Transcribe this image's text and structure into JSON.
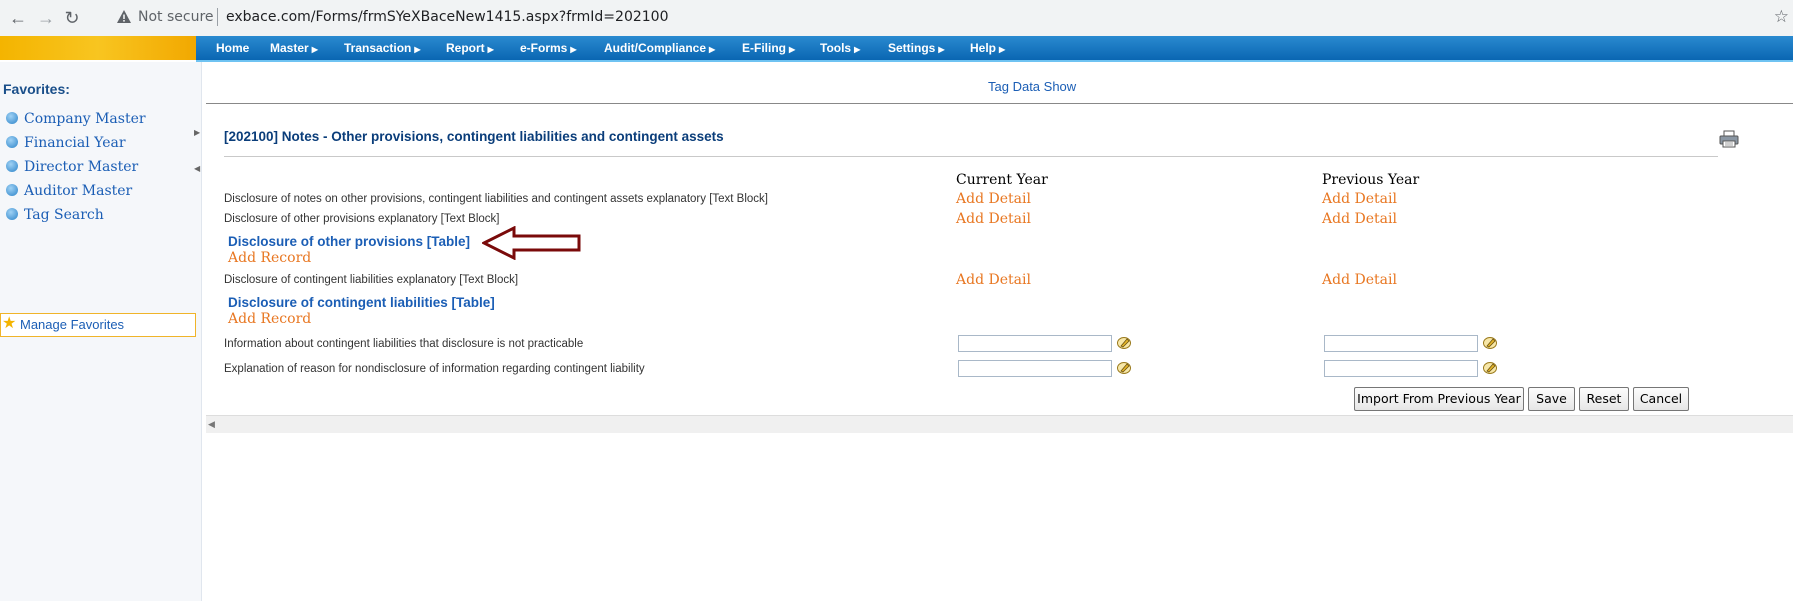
{
  "browser": {
    "security_label": "Not secure",
    "url": "exbace.com/Forms/frmSYeXBaceNew1415.aspx?frmId=202100"
  },
  "menu": {
    "items": [
      {
        "label": "Home",
        "has_submenu": false
      },
      {
        "label": "Master",
        "has_submenu": true
      },
      {
        "label": "Transaction",
        "has_submenu": true
      },
      {
        "label": "Report",
        "has_submenu": true
      },
      {
        "label": "e-Forms",
        "has_submenu": true
      },
      {
        "label": "Audit/Compliance",
        "has_submenu": true
      },
      {
        "label": "E-Filing",
        "has_submenu": true
      },
      {
        "label": "Tools",
        "has_submenu": true
      },
      {
        "label": "Settings",
        "has_submenu": true
      },
      {
        "label": "Help",
        "has_submenu": true
      }
    ]
  },
  "sidebar": {
    "title": "Favorites:",
    "items": [
      {
        "label": "Company Master"
      },
      {
        "label": "Financial Year"
      },
      {
        "label": "Director Master"
      },
      {
        "label": "Auditor Master"
      },
      {
        "label": "Tag Search"
      }
    ],
    "manage_label": "Manage Favorites"
  },
  "main": {
    "tag_data_link": "Tag Data Show",
    "form_title": "[202100] Notes - Other provisions, contingent liabilities and contingent assets",
    "columns": {
      "current": "Current Year",
      "previous": "Previous Year"
    },
    "add_detail_label": "Add Detail",
    "add_record_label": "Add Record",
    "rows": [
      {
        "label": "Disclosure of notes on other provisions, contingent liabilities and contingent assets explanatory [Text Block]"
      },
      {
        "label": "Disclosure of other provisions explanatory [Text Block]"
      },
      {
        "table": "Disclosure of other provisions [Table]"
      },
      {
        "label": "Disclosure of contingent liabilities explanatory [Text Block]"
      },
      {
        "table": "Disclosure of contingent liabilities [Table]"
      },
      {
        "label": "Information about contingent liabilities that disclosure is not practicable",
        "current_value": "",
        "previous_value": ""
      },
      {
        "label": "Explanation of reason for nondisclosure of information regarding contingent liability",
        "current_value": "",
        "previous_value": ""
      }
    ],
    "buttons": {
      "import": "Import From Previous Year",
      "save": "Save",
      "reset": "Reset",
      "cancel": "Cancel"
    }
  },
  "colors": {
    "menu_blue": "#0a66b2",
    "link_blue": "#1b5eb5",
    "title_navy": "#0a3d7a",
    "add_orange": "#e87722",
    "annotation_red": "#7a0a0a"
  }
}
